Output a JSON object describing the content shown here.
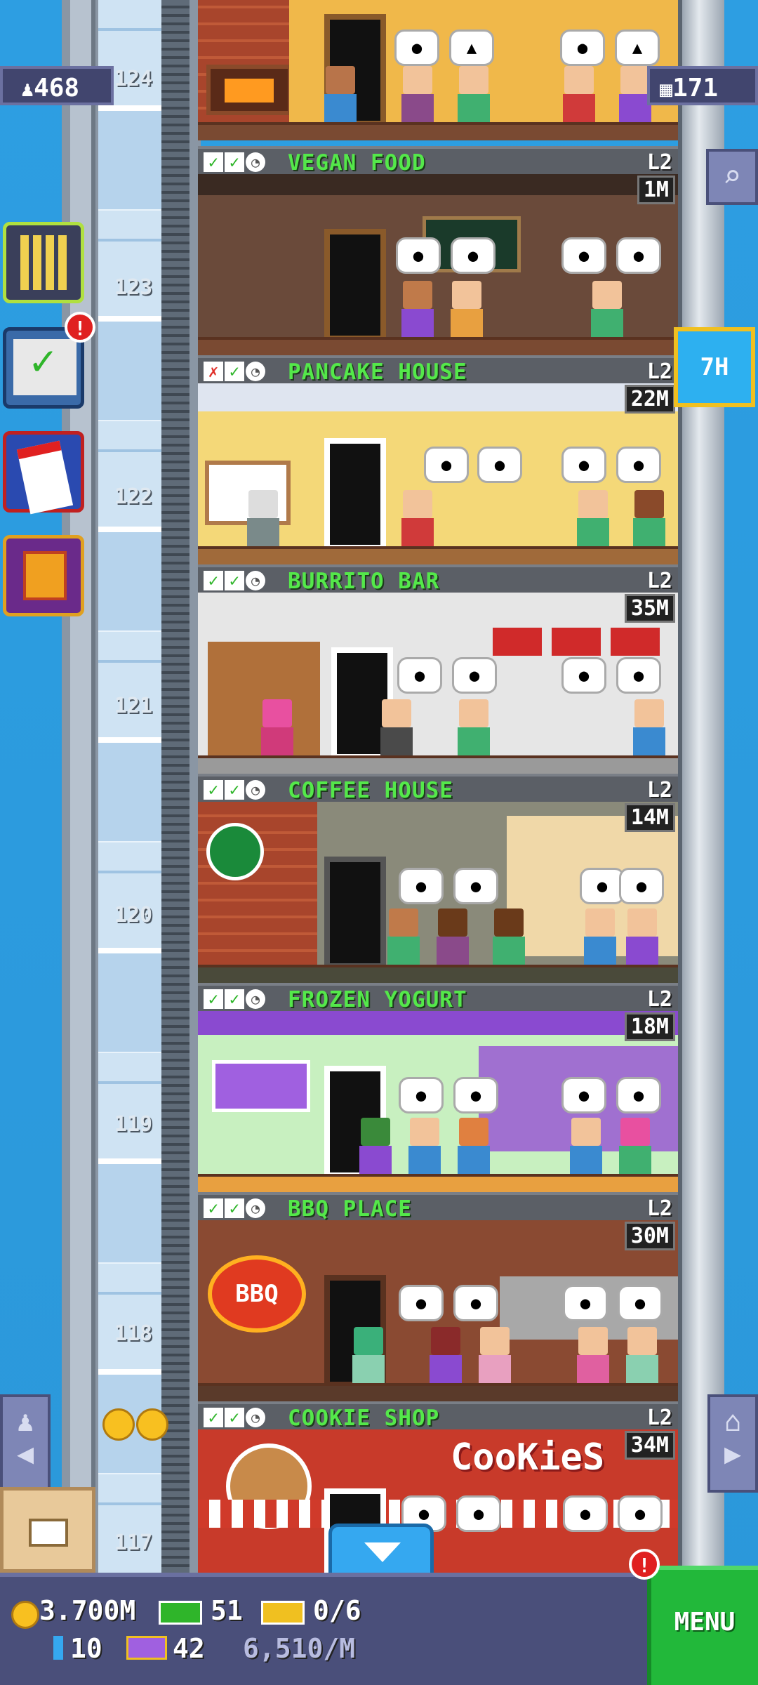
{
  "hud_top": {
    "population": "468",
    "floors": "171"
  },
  "timer": {
    "label": "7H"
  },
  "floors": [
    {
      "number": "124",
      "name": "",
      "level": "",
      "stock": ""
    },
    {
      "number": "123",
      "name": "VEGAN FOOD",
      "level": "L2",
      "stock": "1M",
      "status": [
        "ok",
        "ok",
        "clock"
      ]
    },
    {
      "number": "122",
      "name": "PANCAKE HOUSE",
      "level": "L2",
      "stock": "22M",
      "status": [
        "bad",
        "ok",
        "clock"
      ]
    },
    {
      "number": "121",
      "name": "BURRITO BAR",
      "level": "L2",
      "stock": "35M",
      "status": [
        "ok",
        "ok",
        "clock"
      ]
    },
    {
      "number": "120",
      "name": "COFFEE HOUSE",
      "level": "L2",
      "stock": "14M",
      "status": [
        "ok",
        "ok",
        "clock"
      ]
    },
    {
      "number": "119",
      "name": "FROZEN YOGURT",
      "level": "L2",
      "stock": "18M",
      "status": [
        "ok",
        "ok",
        "clock"
      ]
    },
    {
      "number": "118",
      "name": "BBQ PLACE",
      "level": "L2",
      "stock": "30M",
      "status": [
        "ok",
        "ok",
        "clock"
      ]
    },
    {
      "number": "117",
      "name": "COOKIE SHOP",
      "level": "L2",
      "stock": "34M",
      "status": [
        "ok",
        "ok",
        "clock"
      ]
    }
  ],
  "signs": {
    "bbq": "BBQ",
    "cookies": "CooKieS"
  },
  "side_buttons": {
    "tasks_badge": "!"
  },
  "hud_bottom": {
    "coins": "3.700M",
    "bux": "51",
    "tickets": "0/6",
    "elevator_count": "10",
    "vip": "42",
    "income": "6,510/M",
    "menu_label": "MENU",
    "menu_badge": "!"
  },
  "colors": {
    "floor_name": "#54e84a",
    "hud_bg": "#4a4f7a",
    "menu_bg": "#22b83a",
    "sky": "#2d9ee2"
  }
}
